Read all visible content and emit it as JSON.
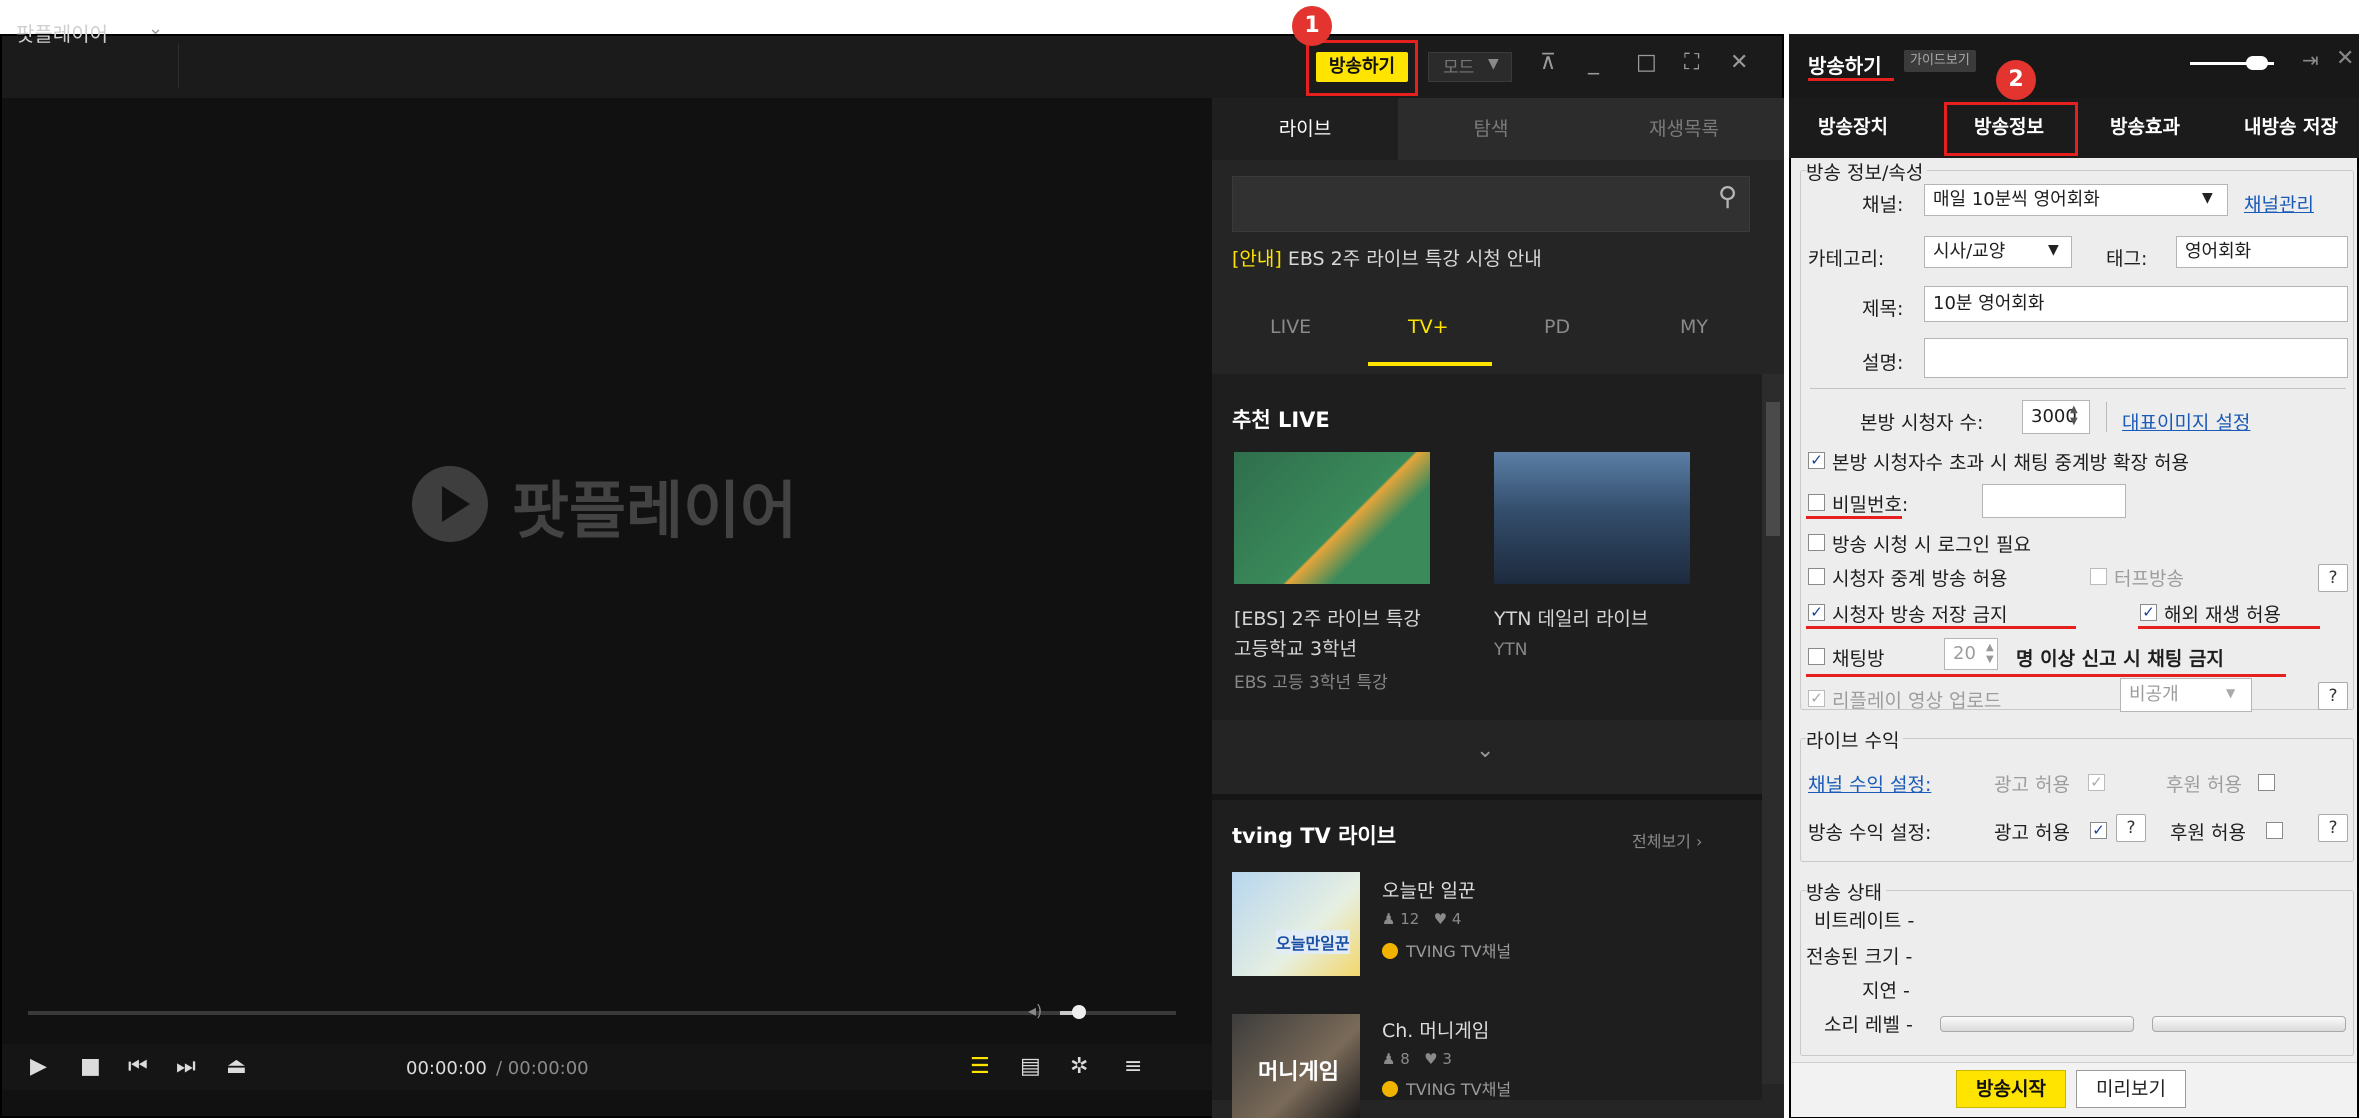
{
  "player": {
    "app_name": "팟플레이어",
    "logo_text": "팟플레이어",
    "broadcast_label": "방송하기",
    "mode_label": "모드",
    "time_current": "00:00:00",
    "time_total": " / 00:00:00",
    "tabs": [
      "라이브",
      "탐색",
      "재생목록"
    ],
    "notice_tag": "[안내]",
    "notice_text": " EBS 2주 라이브 특강 시청 안내",
    "subtabs": [
      "LIVE",
      "TV+",
      "PD",
      "MY"
    ],
    "recommended_title": "추천 LIVE",
    "cards": [
      {
        "title": "[EBS] 2주 라이브 특강",
        "title2": "고등학교 3학년",
        "sub": "EBS 고등 3학년 특강"
      },
      {
        "title": "YTN 데일리 라이브",
        "title2": "",
        "sub": "YTN"
      }
    ],
    "tving_title": "tving TV 라이브",
    "tving_all": "전체보기 ›",
    "tving_items": [
      {
        "name": "오늘만 일꾼",
        "viewers": "12",
        "likes": "4",
        "channel": "TVING TV채널",
        "thumb_text": "오늘만일꾼"
      },
      {
        "name": "Ch. 머니게임",
        "viewers": "8",
        "likes": "3",
        "channel": "TVING TV채널",
        "thumb_text": "머니게임"
      }
    ]
  },
  "panel": {
    "title": "방송하기",
    "guide_label": "가이드보기",
    "tabs": [
      "방송장치",
      "방송정보",
      "방송효과",
      "내방송 저장"
    ],
    "section_info": "방송 정보/속성",
    "channel_label": "채널:",
    "channel_value": "매일 10분씩 영어회화",
    "channel_manage": "채널관리",
    "category_label": "카테고리:",
    "category_value": "시사/교양",
    "tag_label": "태그:",
    "tag_value": "영어회화",
    "title_label": "제목:",
    "title_value": "10분 영어회화",
    "desc_label": "설명:",
    "desc_value": "",
    "viewers_label": "본방 시청자 수:",
    "viewers_value": "3000",
    "rep_image": "대표이미지 설정",
    "opt_expand": "본방 시청자수 초과 시 채팅 중계방 확장 허용",
    "opt_password": "비밀번호:",
    "opt_login": "방송 시청 시 로그인 필요",
    "opt_relay": "시청자 중계 방송 허용",
    "opt_turf": "터프방송",
    "opt_save_ban": "시청자 방송 저장 금지",
    "opt_overseas": "해외 재생 허용",
    "opt_chat_ban_pre": "채팅방",
    "opt_chat_count": "20",
    "opt_chat_ban_post": "명 이상 신고 시 채팅 금지",
    "opt_replay": "리플레이 영상 업로드",
    "replay_value": "비공개",
    "section_income": "라이브 수익",
    "channel_income": "채널 수익 설정:",
    "ad_allow": "광고 허용",
    "donate_allow": "후원 허용",
    "broadcast_income": "방송 수익 설정:",
    "section_status": "방송 상태",
    "bitrate": "비트레이트 -",
    "sent_size": "전송된 크기 -",
    "delay": "지연 -",
    "sound_level": "소리 레벨 -",
    "start_label": "방송시작",
    "preview_label": "미리보기",
    "question": "?"
  },
  "callouts": {
    "one": "1",
    "two": "2"
  }
}
